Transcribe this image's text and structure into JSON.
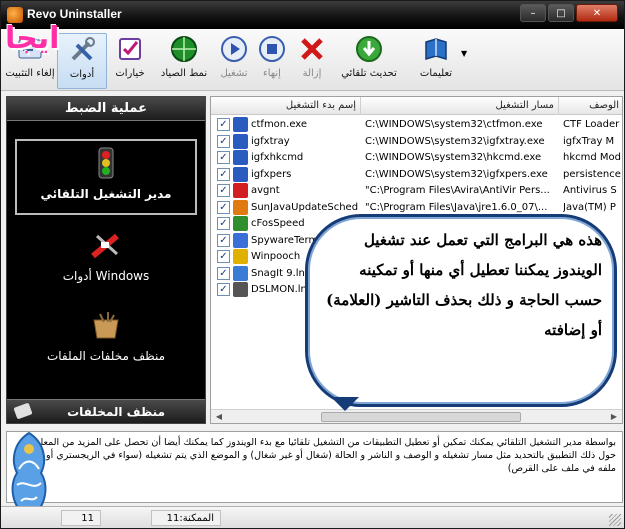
{
  "window": {
    "title": "Revo Uninstaller",
    "logo_text": "ايجا",
    "controls": {
      "minimize": "–",
      "maximize": "□",
      "close": "✕"
    }
  },
  "toolbar": {
    "items": [
      {
        "key": "uninstall",
        "label": "إلغاء التثبيت",
        "icon": "uninstall-icon",
        "disabled": false
      },
      {
        "key": "tools",
        "label": "أدوات",
        "icon": "tools-icon",
        "disabled": false,
        "selected": true
      },
      {
        "key": "options",
        "label": "خيارات",
        "icon": "options-icon",
        "disabled": false
      },
      {
        "key": "hunter",
        "label": "نمط الصياد",
        "icon": "hunter-mode-icon",
        "disabled": false
      },
      {
        "key": "run",
        "label": "تشغيل",
        "icon": "run-icon",
        "disabled": true
      },
      {
        "key": "stop",
        "label": "إنهاء",
        "icon": "stop-icon",
        "disabled": true
      },
      {
        "key": "delete",
        "label": "إزالة",
        "icon": "delete-icon",
        "disabled": true
      },
      {
        "key": "autoupdate",
        "label": "تحديث تلقائي",
        "icon": "auto-update-icon",
        "disabled": false
      },
      {
        "key": "help",
        "label": "تعليمات",
        "icon": "help-book-icon",
        "disabled": false
      }
    ]
  },
  "sidebar": {
    "header": "عملية الضبط",
    "items": [
      {
        "label": "مدير التشغيل التلقائي",
        "icon": "traffic-light-icon",
        "active": true
      },
      {
        "label": "أدوات Windows",
        "icon": "windows-tools-icon",
        "active": false
      },
      {
        "label": "منظف مخلفات الملفات",
        "icon": "junk-cleaner-icon",
        "active": false
      }
    ],
    "footer": "منظف المخلفات"
  },
  "list": {
    "columns": [
      "إسم بدء التشغيل",
      "مسار التشغيل",
      "الوصف"
    ],
    "rows": [
      {
        "name": "ctfmon.exe",
        "path": "C:\\WINDOWS\\system32\\ctfmon.exe",
        "desc": "CTF Loader",
        "color": "#2a5bbf"
      },
      {
        "name": "igfxtray",
        "path": "C:\\WINDOWS\\system32\\igfxtray.exe",
        "desc": "igfxTray M",
        "color": "#2a5bbf"
      },
      {
        "name": "igfxhkcmd",
        "path": "C:\\WINDOWS\\system32\\hkcmd.exe",
        "desc": "hkcmd Mod",
        "color": "#2a5bbf"
      },
      {
        "name": "igfxpers",
        "path": "C:\\WINDOWS\\system32\\igfxpers.exe",
        "desc": "persistence",
        "color": "#2a5bbf"
      },
      {
        "name": "avgnt",
        "path": "\"C:\\Program Files\\Avira\\AntiVir Pers...",
        "desc": "Antivirus S",
        "color": "#d21f1f"
      },
      {
        "name": "SunJavaUpdateSched",
        "path": "\"C:\\Program Files\\Java\\jre1.6.0_07\\...",
        "desc": "Java(TM) P",
        "color": "#e07a10"
      },
      {
        "name": "cFosSpeed",
        "path": "",
        "desc": "",
        "color": "#2f8f2f"
      },
      {
        "name": "SpywareTerm",
        "path": "",
        "desc": "",
        "color": "#3a6fd8"
      },
      {
        "name": "Winpooch",
        "path": "",
        "desc": "",
        "color": "#e0b000"
      },
      {
        "name": "SnagIt 9.lnk",
        "path": "",
        "desc": "",
        "color": "#3a7bd5"
      },
      {
        "name": "DSLMON.lnk",
        "path": "",
        "desc": "",
        "color": "#555555"
      }
    ]
  },
  "callout": {
    "text": "هذه هي البرامج التي تعمل عند تشغيل الويندوز يمكننا تعطيل أي منها أو تمكينه حسب الحاجة و ذلك بحذف التاشير (العلامة) أو إضافته"
  },
  "description": {
    "text": "بواسطة مدير التشغيل التلقائي يمكنك تمكين أو تعطيل التطبيقات من التشغيل تلقائيا مع بدء الويندوز كما يمكنك أيضا أن تحصل على المزيد من المعلومات حول ذلك التطبيق بالتحديد مثل مسار تشغيله و الوصف و الناشر و الحالة (شغال أو غير شغال) و الموضع الذي يتم تشغيله (سواء في الريجستري أو في ملفه في ملف على القرص)"
  },
  "status": {
    "count_text": "الممكنة:11",
    "total_text": "11"
  }
}
